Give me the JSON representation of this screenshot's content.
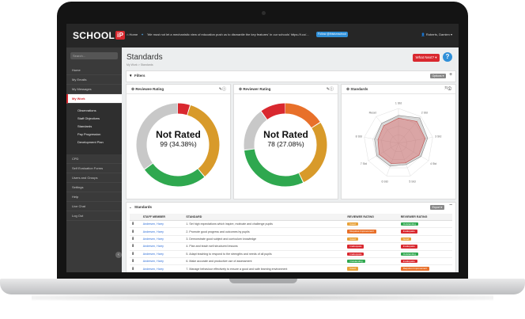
{
  "topbar": {
    "logo": "SCHOOL",
    "logo_ip": "iP",
    "home": "Home",
    "tweet": "'We must not let a mechanistic view of education push us to dismantle the key features' in our schools' https://t.co/...",
    "follow_label": "Follow @thisismschool",
    "user": "Roberts, Damien"
  },
  "sidebar": {
    "search_placeholder": "Search...",
    "items": [
      {
        "label": "Home"
      },
      {
        "label": "My Emails"
      },
      {
        "label": "My Messages"
      },
      {
        "label": "My Work"
      }
    ],
    "sub_items": [
      {
        "label": "Observations"
      },
      {
        "label": "Staff Objectives"
      },
      {
        "label": "Standards"
      },
      {
        "label": "Pay Progression"
      },
      {
        "label": "Development Plan"
      }
    ],
    "lower_items": [
      {
        "label": "CPD"
      },
      {
        "label": "Self Evaluation Forms"
      },
      {
        "label": "Users and Groups"
      },
      {
        "label": "Settings"
      },
      {
        "label": "Help"
      },
      {
        "label": "Live Chat"
      },
      {
        "label": "Log Out"
      }
    ]
  },
  "page": {
    "title": "Standards",
    "breadcrumb": "My Work > Standards",
    "what_next": "What Next?",
    "help": "?"
  },
  "filters": {
    "title": "Filters",
    "options_label": "Options"
  },
  "reviewee_card": {
    "title": "Reviewee Rating",
    "center_label": "Not Rated",
    "center_value": "99 (34.38%)",
    "segments": [
      {
        "color": "#d9282f",
        "fraction": 0.05
      },
      {
        "color": "#d89a2a",
        "fraction": 0.34
      },
      {
        "color": "#2fa84f",
        "fraction": 0.26
      },
      {
        "color": "#c8c8c8",
        "fraction": 0.35
      }
    ]
  },
  "reviewer_card": {
    "title": "Reviewer Rating",
    "center_label": "Not Rated",
    "center_value": "78 (27.08%)",
    "segments": [
      {
        "color": "#e8702a",
        "fraction": 0.16
      },
      {
        "color": "#d89a2a",
        "fraction": 0.27
      },
      {
        "color": "#2fa84f",
        "fraction": 0.3
      },
      {
        "color": "#c8c8c8",
        "fraction": 0.17
      },
      {
        "color": "#d9282f",
        "fraction": 0.1
      }
    ]
  },
  "standards_card": {
    "title": "Standards",
    "radar_labels": [
      "1 Std",
      "2 Std",
      "3 Std",
      "4 Std",
      "5 Std",
      "6 Std",
      "7 Std",
      "8 Std",
      "Reset"
    ]
  },
  "standards_panel": {
    "title": "Standards",
    "export_label": "Export",
    "columns": [
      "STAFF MEMBER",
      "STANDARD",
      "REVIEWEE RATING",
      "REVIEWER RATING"
    ],
    "rows": [
      {
        "staff": "Andersen, Harry",
        "standard": "1. Set high expectations which inspire, motivate and challenge pupils",
        "reviewee": "Good",
        "reviewee_color": "#e8a23a",
        "reviewer": "Outstanding",
        "reviewer_color": "#2fa84f"
      },
      {
        "staff": "Andersen, Harry",
        "standard": "2. Promote good progress and outcomes by pupils",
        "reviewee": "Requires Improvement",
        "reviewee_color": "#e8702a",
        "reviewer": "Inadequate",
        "reviewer_color": "#d9282f"
      },
      {
        "staff": "Andersen, Harry",
        "standard": "3. Demonstrate good subject and curriculum knowledge",
        "reviewee": "Good",
        "reviewee_color": "#e8a23a",
        "reviewer": "Good",
        "reviewer_color": "#e8a23a"
      },
      {
        "staff": "Andersen, Harry",
        "standard": "4. Plan and teach well structured lessons",
        "reviewee": "Inadequate",
        "reviewee_color": "#d9282f",
        "reviewer": "Inadequate",
        "reviewer_color": "#d9282f"
      },
      {
        "staff": "Andersen, Harry",
        "standard": "5. Adapt teaching to respond to the strengths and needs of all pupils",
        "reviewee": "Inadequate",
        "reviewee_color": "#d9282f",
        "reviewer": "Outstanding",
        "reviewer_color": "#2fa84f"
      },
      {
        "staff": "Andersen, Harry",
        "standard": "6. Make accurate and productive use of assessment",
        "reviewee": "Outstanding",
        "reviewee_color": "#2fa84f",
        "reviewer": "Inadequate",
        "reviewer_color": "#d9282f"
      },
      {
        "staff": "Andersen, Harry",
        "standard": "7. Manage behaviour effectively to ensure a good and safe learning environment",
        "reviewee": "Good",
        "reviewee_color": "#e8a23a",
        "reviewer": "Requires Improvement",
        "reviewer_color": "#e8702a"
      },
      {
        "staff": "Andersen, Harry",
        "standard": "8. Fulfil wider professional responsibilities",
        "reviewee": "Requires Improvement",
        "reviewee_color": "#e8702a",
        "reviewer": "Outstanding",
        "reviewer_color": "#2fa84f"
      }
    ]
  }
}
